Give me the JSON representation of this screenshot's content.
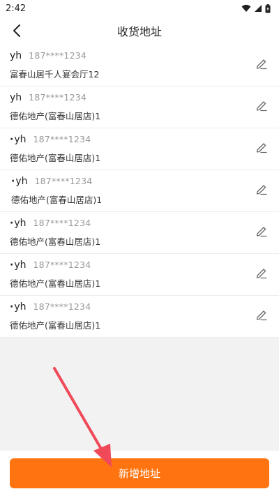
{
  "status_bar": {
    "time": "2:42"
  },
  "header": {
    "title": "收货地址"
  },
  "addresses": [
    {
      "name": "yh",
      "phone": "187****1234",
      "address": "富春山居千人宴会厅12"
    },
    {
      "name": "yh",
      "phone": "187****1234",
      "address": "德佑地产(富春山居店)1"
    },
    {
      "name": "yh",
      "phone": "187****1234",
      "address": "德佑地产(富春山居店)1"
    },
    {
      "name": "yh",
      "phone": "187****1234",
      "address": "德佑地产(富春山居店)1"
    },
    {
      "name": "yh",
      "phone": "187****1234",
      "address": "德佑地产(富春山居店)1"
    },
    {
      "name": "yh",
      "phone": "187****1234",
      "address": "德佑地产(富春山居店)1"
    },
    {
      "name": "yh",
      "phone": "187****1234",
      "address": "德佑地产(富春山居店)1"
    }
  ],
  "footer": {
    "add_button_label": "新增地址"
  },
  "colors": {
    "accent": "#ff7410",
    "annotation_arrow": "#f04a5a"
  },
  "icons": [
    "wifi-icon",
    "signal-icon",
    "battery-icon",
    "back-arrow-icon",
    "edit-pencil-icon"
  ]
}
